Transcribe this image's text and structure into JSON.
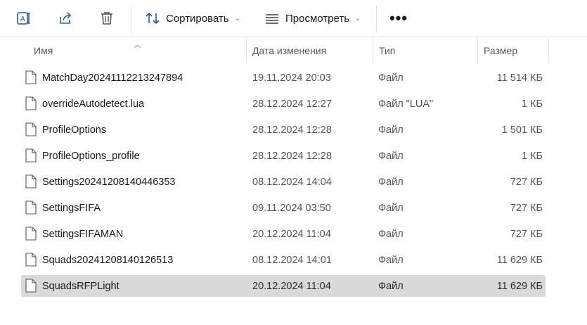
{
  "toolbar": {
    "rename_icon": "rename-icon",
    "share_icon": "share-icon",
    "delete_icon": "trash-icon",
    "sort_label": "Сортировать",
    "view_label": "Просмотреть",
    "more_label": "•••"
  },
  "columns": {
    "name": "Имя",
    "date": "Дата изменения",
    "type": "Тип",
    "size": "Размер"
  },
  "files": [
    {
      "name": "MatchDay20241112213247894",
      "date": "19.11.2024 20:03",
      "type": "Файл",
      "size": "11 514 КБ",
      "selected": false
    },
    {
      "name": "overrideAutodetect.lua",
      "date": "28.12.2024 12:27",
      "type": "Файл \"LUA\"",
      "size": "1 КБ",
      "selected": false
    },
    {
      "name": "ProfileOptions",
      "date": "28.12.2024 12:28",
      "type": "Файл",
      "size": "1 501 КБ",
      "selected": false
    },
    {
      "name": "ProfileOptions_profile",
      "date": "28.12.2024 12:28",
      "type": "Файл",
      "size": "1 КБ",
      "selected": false
    },
    {
      "name": "Settings20241208140446353",
      "date": "08.12.2024 14:04",
      "type": "Файл",
      "size": "727 КБ",
      "selected": false
    },
    {
      "name": "SettingsFIFA",
      "date": "09.11.2024 03:50",
      "type": "Файл",
      "size": "727 КБ",
      "selected": false
    },
    {
      "name": "SettingsFIFAMAN",
      "date": "20.12.2024 11:04",
      "type": "Файл",
      "size": "727 КБ",
      "selected": false
    },
    {
      "name": "Squads20241208140126513",
      "date": "08.12.2024 14:01",
      "type": "Файл",
      "size": "11 629 КБ",
      "selected": false
    },
    {
      "name": "SquadsRFPLight",
      "date": "20.12.2024 11:04",
      "type": "Файл",
      "size": "11 629 КБ",
      "selected": true
    }
  ],
  "colors": {
    "selection": "#d9d9d9",
    "accent_icon": "#1f4e79"
  }
}
